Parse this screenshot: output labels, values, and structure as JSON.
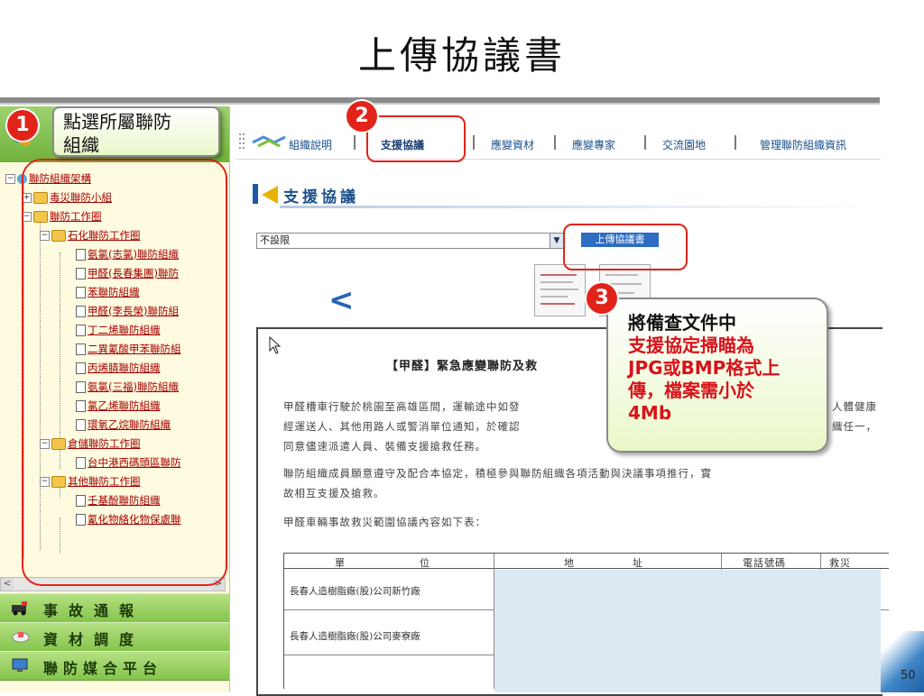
{
  "slide": {
    "title": "上傳協議書",
    "page_number": "50"
  },
  "left_panel": {
    "tree": [
      {
        "label": "聯防組織架構"
      },
      {
        "label": "毒災聯防小組"
      },
      {
        "label": "聯防工作圈"
      },
      {
        "label": "石化聯防工作圈"
      },
      {
        "label": "氨氯(志氯)聯防組織"
      },
      {
        "label": "甲醛(長春集團)聯防"
      },
      {
        "label": "苯聯防組織"
      },
      {
        "label": "甲醛(李長榮)聯防組"
      },
      {
        "label": "丁二烯聯防組織"
      },
      {
        "label": "二異氰酸甲苯聯防組"
      },
      {
        "label": "丙烯腈聯防組織"
      },
      {
        "label": "氨氯(三福)聯防組織"
      },
      {
        "label": "氯乙烯聯防組織"
      },
      {
        "label": "環氧乙烷聯防組織"
      },
      {
        "label": "倉儲聯防工作圈"
      },
      {
        "label": "台中港西碼頭區聯防"
      },
      {
        "label": "其他聯防工作圈"
      },
      {
        "label": "壬基酚聯防組織"
      },
      {
        "label": "氰化物絡化物保處聯"
      }
    ],
    "menu_buttons": [
      {
        "label": "事故通報"
      },
      {
        "label": "資材調度"
      },
      {
        "label": "聯防媒合平台"
      }
    ]
  },
  "nav": {
    "items": [
      {
        "label": "組織說明"
      },
      {
        "label": "支援協議"
      },
      {
        "label": "應變資材"
      },
      {
        "label": "應變專家"
      },
      {
        "label": "交流園地"
      },
      {
        "label": "管理聯防組織資訊"
      }
    ]
  },
  "content": {
    "section_title": "支援協議",
    "select_value": "不設限",
    "upload_button": "上傳協議書",
    "back_arrow": "<",
    "document": {
      "title": "【甲醛】緊急應變聯防及救",
      "p1a": "甲醛槽車行駛於桃園至高雄區間，運輸途中如發",
      "p1b": "人體健康",
      "p2a": "經運送人、其他用路人或警消單位通知，於確認",
      "p2b": "織任一，",
      "p3": "同意儘速派遣人員、裝備支援搶救任務。",
      "p4": "聯防組織成員願意遵守及配合本協定，積極參與聯防組織各項活動與決議事項推行，實",
      "p5": "故相互支援及搶救。",
      "p6": "甲醛車輛事故救災範圍協議內容如下表：",
      "table_headers": [
        "單",
        "位",
        "地",
        "址",
        "電話號碼",
        "救災"
      ],
      "table_rows": [
        "長春人造樹脂廠(股)公司新竹廠",
        "長春人造樹脂廠(股)公司麥寮廠"
      ]
    }
  },
  "annotations": {
    "badge1": "1",
    "badge2": "2",
    "badge3": "3",
    "callout1_line1": "點選所屬聯防",
    "callout1_line2": "組織",
    "callout3_line1": "將備查文件中",
    "callout3_line2": "支援協定掃瞄為",
    "callout3_line3": "JPG或BMP格式上",
    "callout3_line4": "傳，檔案需小於",
    "callout3_line5": "4Mb"
  },
  "colors": {
    "accent_red": "#e2231a",
    "nav_blue": "#1a4f8a",
    "menu_green": "#84c44c",
    "callout_red_text": "#d8121a"
  }
}
